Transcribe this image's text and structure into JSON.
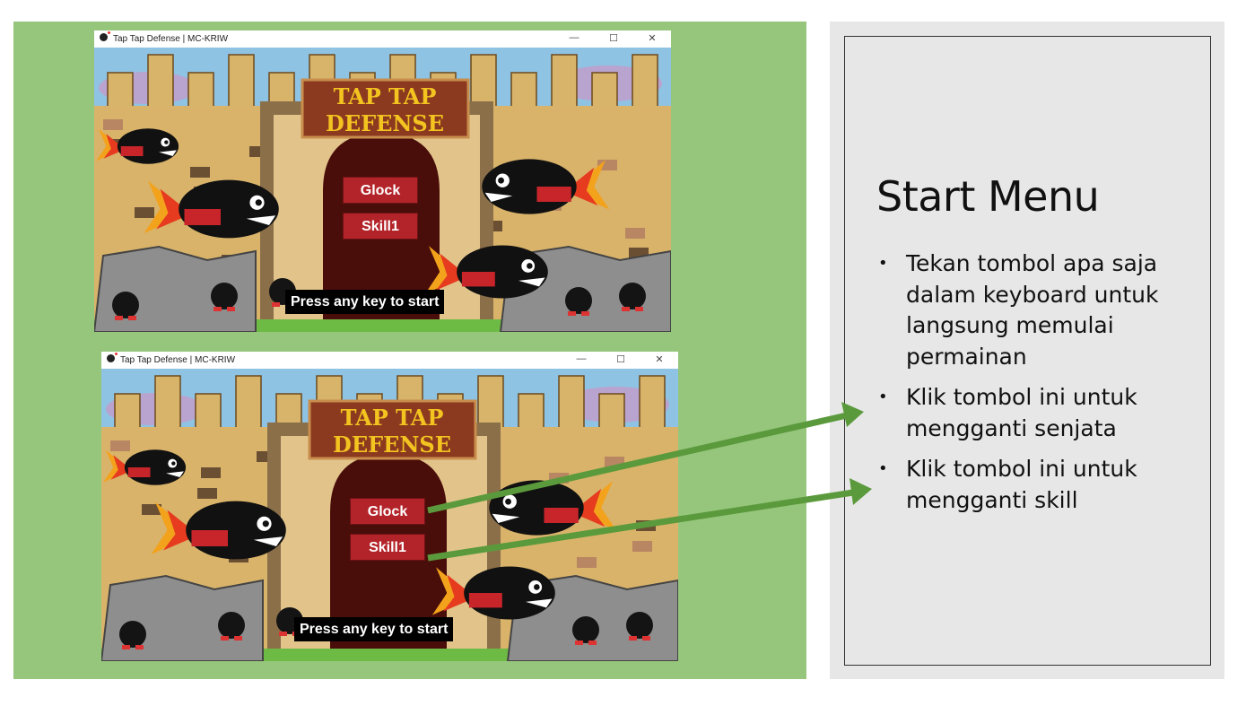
{
  "slide": {
    "heading": "Start Menu",
    "bullets": [
      "Tekan tombol apa saja dalam keyboard untuk langsung memulai permainan",
      "Klik tombol ini untuk mengganti senjata",
      "Klik tombol ini untuk mengganti skill"
    ]
  },
  "game_windows": [
    {
      "title": "Tap Tap Defense | MC-KRIW",
      "sign_line1": "TAP TAP",
      "sign_line2": "DEFENSE",
      "weapon_button": "Glock",
      "skill_button": "Skill1",
      "start_prompt": "Press any key to start"
    },
    {
      "title": "Tap Tap Defense | MC-KRIW",
      "sign_line1": "TAP TAP",
      "sign_line2": "DEFENSE",
      "weapon_button": "Glock",
      "skill_button": "Skill1",
      "start_prompt": "Press any key to start"
    }
  ],
  "window_controls": {
    "minimize": "—",
    "maximize": "☐",
    "close": "✕"
  },
  "colors": {
    "green_panel": "#96c67c",
    "gray_panel": "#e7e7e7",
    "arrow": "#5b9a3c",
    "button_red": "#b3242a",
    "sign_brown": "#8b3a1f",
    "sign_text": "#f3c320"
  },
  "icons": [
    "bomb-app-icon",
    "minimize-icon",
    "maximize-icon",
    "close-icon",
    "bullet-icon"
  ]
}
